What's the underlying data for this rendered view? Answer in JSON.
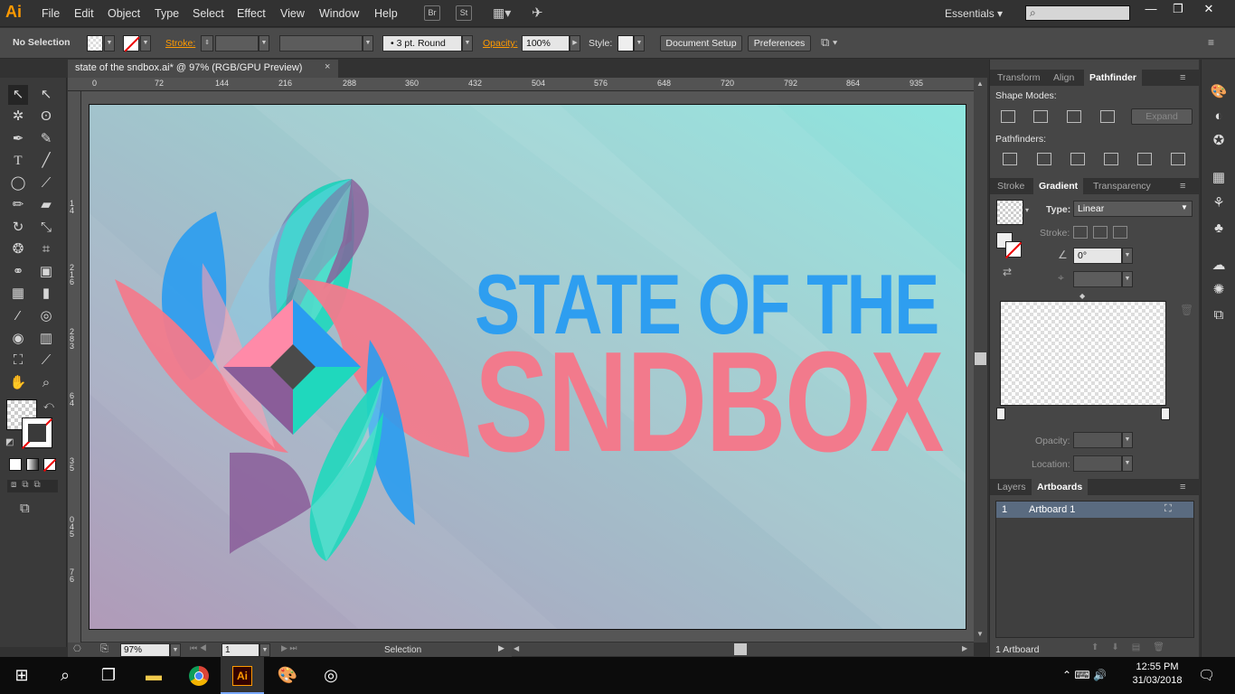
{
  "app": {
    "logo": "Ai",
    "workspace": "Essentials",
    "workspace_arrow": "▾"
  },
  "menu": [
    "File",
    "Edit",
    "Object",
    "Type",
    "Select",
    "Effect",
    "View",
    "Window",
    "Help"
  ],
  "menu_buttons": [
    "Br",
    "St"
  ],
  "window_controls": {
    "minimize": "—",
    "restore": "❐",
    "close": "✕"
  },
  "control_bar": {
    "selection": "No Selection",
    "stroke_label": "Stroke:",
    "brush": "3 pt. Round",
    "opacity_label": "Opacity:",
    "opacity_value": "100%",
    "style_label": "Style:",
    "document_setup": "Document Setup",
    "preferences": "Preferences"
  },
  "document_tab": {
    "title": "state of the sndbox.ai* @ 97% (RGB/GPU Preview)",
    "close": "×"
  },
  "ruler_h": [
    "0",
    "72",
    "144",
    "216",
    "288",
    "360",
    "432",
    "504",
    "576",
    "648",
    "720",
    "792",
    "864",
    "935"
  ],
  "ruler_v": [
    "1",
    "1",
    "2",
    "2",
    "3",
    "3",
    "4",
    "4",
    "5",
    "5",
    "6"
  ],
  "ruler_v_full": [
    "1",
    "4",
    "2",
    "1",
    "6",
    "2",
    "8",
    "3",
    "6",
    "4",
    "3",
    "5",
    "0",
    "4",
    "5",
    "7",
    "6"
  ],
  "artwork": {
    "line1": "STATE OF THE",
    "line2": "SNDBOX",
    "line1_color": "#2e9ef0",
    "line2_color": "#f27a8c"
  },
  "status_bar": {
    "zoom": "97%",
    "artboard_number": "1",
    "tool_name": "Selection"
  },
  "panels": {
    "top_tabs": [
      "Transform",
      "Align",
      "Pathfinder"
    ],
    "shape_modes": "Shape Modes:",
    "expand": "Expand",
    "pathfinders": "Pathfinders:",
    "mid_tabs": [
      "Stroke",
      "Gradient",
      "Transparency"
    ],
    "gradient": {
      "type_label": "Type:",
      "type_value": "Linear",
      "stroke_label": "Stroke:",
      "angle": "0°",
      "opacity_label": "Opacity:",
      "location_label": "Location:"
    },
    "bottom_tabs": [
      "Layers",
      "Artboards"
    ],
    "artboards": [
      {
        "num": "1",
        "name": "Artboard 1"
      }
    ],
    "artboards_count": "1 Artboard"
  },
  "taskbar": {
    "time": "12:55 PM",
    "date": "31/03/2018"
  }
}
